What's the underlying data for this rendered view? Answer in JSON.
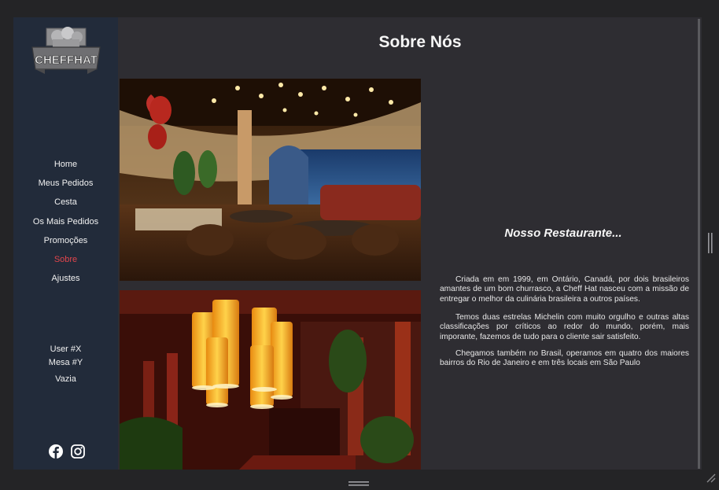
{
  "page_title": "Sobre Nós",
  "logo_text": "CHEFFHAT",
  "nav": [
    {
      "label": "Home",
      "active": false
    },
    {
      "label": "Meus Pedidos",
      "active": false
    },
    {
      "label": "Cesta",
      "active": false
    },
    {
      "label": "Os Mais Pedidos",
      "active": false
    },
    {
      "label": "Promoções",
      "active": false
    },
    {
      "label": "Sobre",
      "active": true
    },
    {
      "label": "Ajustes",
      "active": false
    }
  ],
  "user": {
    "name": "User #X",
    "table": "Mesa #Y",
    "status": "Vazia"
  },
  "social": [
    "facebook-icon",
    "instagram-icon"
  ],
  "section_title": "Nosso Restaurante...",
  "paragraphs": [
    "Criada em em 1999, em Ontário, Canadá, por dois brasileiros amantes de um bom churrasco, a Cheff Hat nasceu com a missão de entregar o melhor da culinária brasileira a outros países.",
    "Temos duas estrelas Michelin com muito orgulho e outras altas classificações por críticos ao redor do mundo, porém, mais imporante, fazemos de tudo para o cliente sair satisfeito.",
    "Chegamos também no Brasil, operamos em quatro dos maiores bairros do Rio de Janeiro e em três locais em São Paulo"
  ],
  "colors": {
    "sidebar": "#222b3a",
    "content": "#2e2d32",
    "active_nav": "#e0454c",
    "frame": "#242426"
  }
}
